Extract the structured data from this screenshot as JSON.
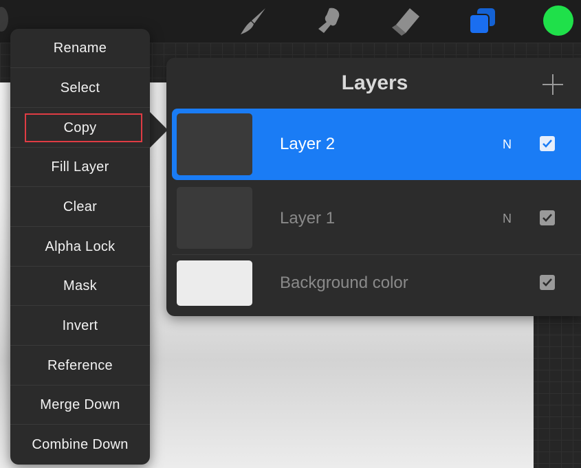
{
  "toolbar": {
    "tools": [
      {
        "icon": "brush-icon",
        "active": false
      },
      {
        "icon": "smudge-icon",
        "active": false
      },
      {
        "icon": "eraser-icon",
        "active": false
      },
      {
        "icon": "layers-icon",
        "active": true
      }
    ],
    "active_color": "#1fe04a",
    "accent_color": "#1a7cf5"
  },
  "context_menu": {
    "items": [
      {
        "label": "Rename"
      },
      {
        "label": "Select"
      },
      {
        "label": "Copy"
      },
      {
        "label": "Fill Layer"
      },
      {
        "label": "Clear"
      },
      {
        "label": "Alpha Lock"
      },
      {
        "label": "Mask"
      },
      {
        "label": "Invert"
      },
      {
        "label": "Reference"
      },
      {
        "label": "Merge Down"
      },
      {
        "label": "Combine Down"
      }
    ],
    "highlighted_item": "Copy"
  },
  "layers_panel": {
    "title": "Layers",
    "add_icon": "plus-icon",
    "layers": [
      {
        "name": "Layer 2",
        "blend_mode": "N",
        "visible": true,
        "selected": true
      },
      {
        "name": "Layer 1",
        "blend_mode": "N",
        "visible": true,
        "selected": false
      },
      {
        "name": "Background color",
        "blend_mode": "",
        "visible": true,
        "selected": false
      }
    ]
  }
}
